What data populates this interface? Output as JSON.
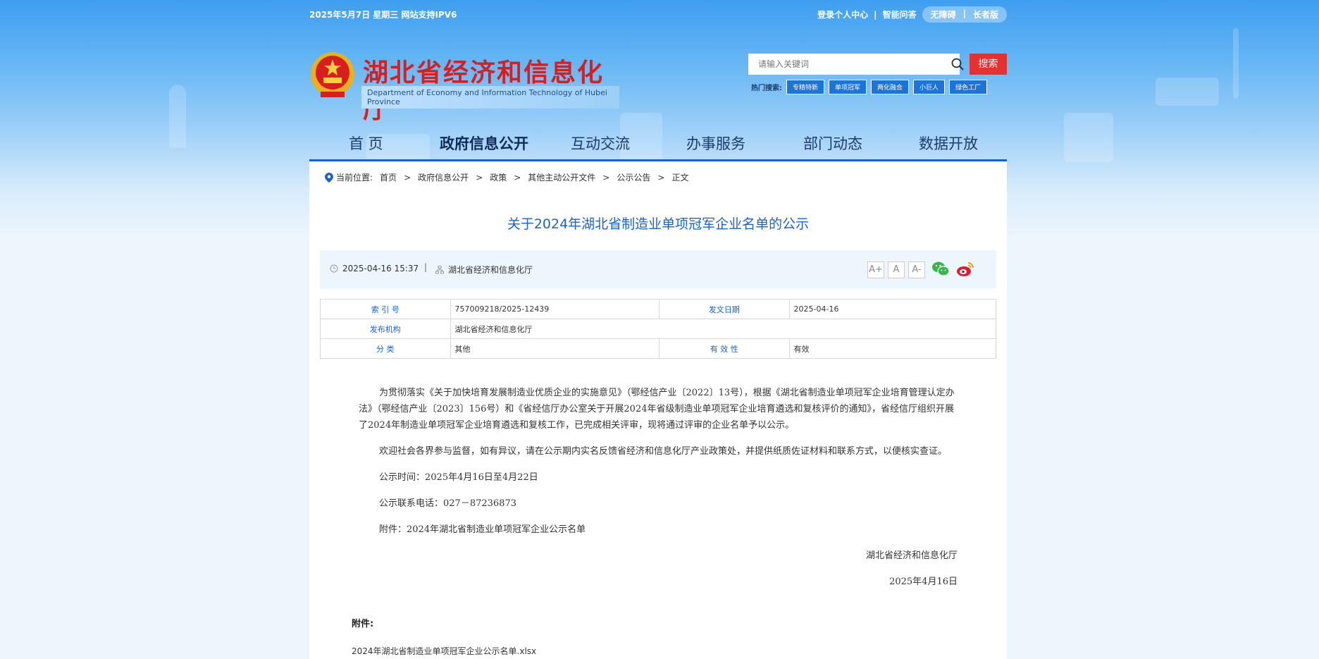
{
  "topbar": {
    "date": "2025年5月7日 星期三  网站支持IPV6",
    "login": "登录个人中心",
    "separator": "|",
    "qa": "智能问答",
    "accessible": "无障碍",
    "pill_sep": "|",
    "elder": "长者版"
  },
  "site": {
    "title": "湖北省经济和信息化厅",
    "english": "Department of Economy and Information Technology of Hubei Province"
  },
  "search": {
    "placeholder": "请输入关键词",
    "button": "搜索",
    "hot_label": "热门搜索:",
    "hot_tags": [
      "专精特新",
      "单项冠军",
      "两化融合",
      "小巨人",
      "绿色工厂"
    ]
  },
  "nav": {
    "items": [
      "首  页",
      "政府信息公开",
      "互动交流",
      "办事服务",
      "部门动态",
      "数据开放"
    ],
    "active_index": 1
  },
  "breadcrumb": {
    "label": "当前位置:",
    "items": [
      "首页",
      "政府信息公开",
      "政策",
      "其他主动公开文件",
      "公示公告",
      "正文"
    ],
    "sep": ">"
  },
  "article": {
    "title": "关于2024年湖北省制造业单项冠军企业名单的公示",
    "datetime": "2025-04-16 15:37",
    "meta_sep": "|",
    "source": "湖北省经济和信息化厅",
    "font_sizes": [
      "A+",
      "A",
      "A-"
    ],
    "share": [
      "wechat-icon",
      "weibo-icon"
    ]
  },
  "info_table": {
    "index_label": "索 引 号",
    "index_value": "757009218/2025-12439",
    "date_label": "发文日期",
    "date_value": "2025-04-16",
    "org_label": "发布机构",
    "org_value": "湖北省经济和信息化厅",
    "cat_label": "分      类",
    "cat_value": "其他",
    "valid_label": "有 效 性",
    "valid_value": "有效"
  },
  "body": {
    "p1": "为贯彻落实《关于加快培育发展制造业优质企业的实施意见》（鄂经信产业〔2022〕13号），根据《湖北省制造业单项冠军企业培育管理认定办法》（鄂经信产业〔2023〕156号）和《省经信厅办公室关于开展2024年省级制造业单项冠军企业培育遴选和复核评价的通知》，省经信厅组织开展了2024年制造业单项冠军企业培育遴选和复核工作，已完成相关评审，现将通过评审的企业名单予以公示。",
    "p2": "欢迎社会各界参与监督，如有异议，请在公示期内实名反馈省经济和信息化厅产业政策处，并提供纸质佐证材料和联系方式，以便核实查证。",
    "p3": "公示时间：2025年4月16日至4月22日",
    "p4": "公示联系电话：027－87236873",
    "p5": "附件：2024年湖北省制造业单项冠军企业公示名单",
    "sign": "湖北省经济和信息化厅",
    "sign_date": "2025年4月16日"
  },
  "attachment": {
    "label": "附件:",
    "file": "2024年湖北省制造业单项冠军企业公示名单.xlsx"
  },
  "colors": {
    "accent": "#1b63c6",
    "title_red": "#d81e1e",
    "search_red": "#e63131"
  }
}
